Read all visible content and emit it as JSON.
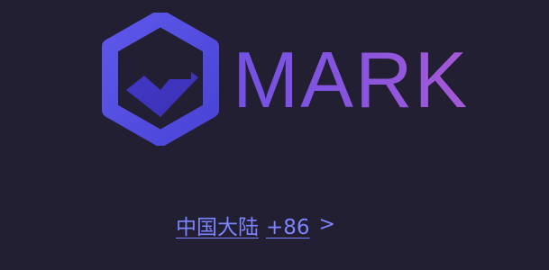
{
  "brand": {
    "name": "MARK",
    "logo_icon": "hexagon-heart-logo-icon",
    "gradient": [
      "#5b4fe0",
      "#a659d6"
    ]
  },
  "region": {
    "label": "中国大陆",
    "code": "+86",
    "chevron": ">",
    "chevron_icon": "chevron-right-icon"
  },
  "theme": {
    "background": "#211f31",
    "accent": "#7d84ff"
  }
}
